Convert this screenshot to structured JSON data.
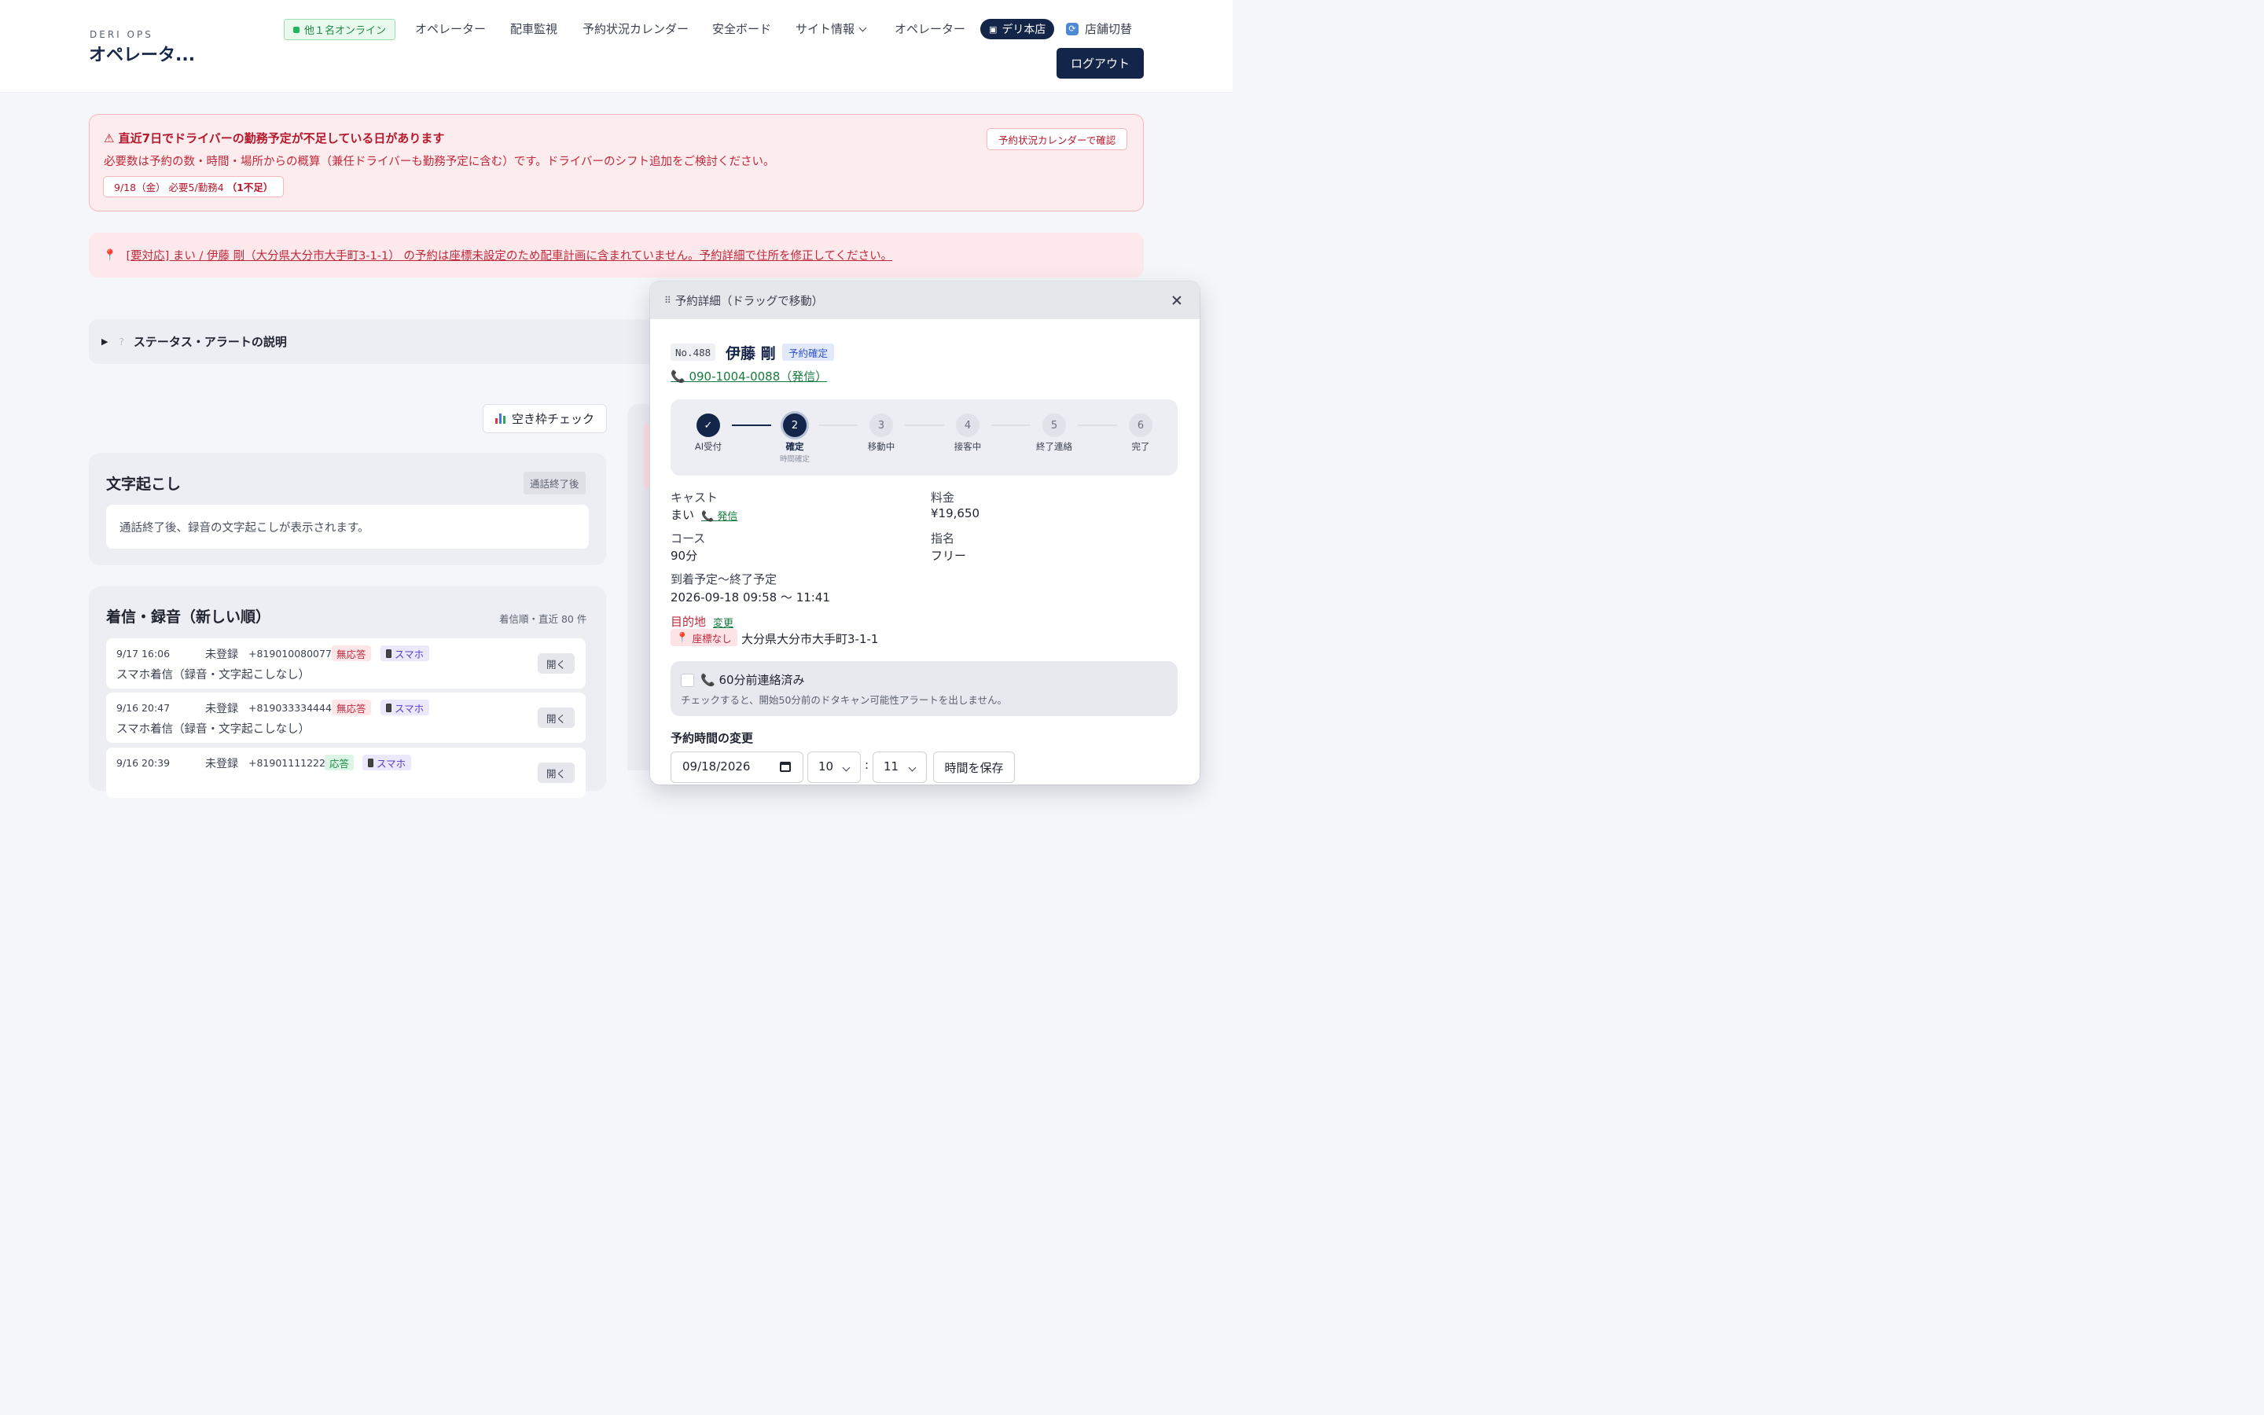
{
  "header": {
    "brand_sub": "DERI OPS",
    "brand_title": "オペレータ...",
    "online_badge": "他１名オンライン",
    "nav": {
      "operator": "オペレーター",
      "dispatch": "配車監視",
      "calendar": "予約状況カレンダー",
      "safety": "安全ボード",
      "site_info": "サイト情報",
      "operator2": "オペレーター"
    },
    "store_label": "デリ本店",
    "store_switch": "店舗切替",
    "logout": "ログアウト"
  },
  "shortage_alert": {
    "title": "⚠ 直近7日でドライバーの勤務予定が不足している日があります",
    "description": "必要数は予約の数・時間・場所からの概算（兼任ドライバーも勤務予定に含む）です。ドライバーのシフト追加をご検討ください。",
    "chip_text": "9/18（金） 必要5/勤務4",
    "chip_strong": "（1不足）",
    "button": "予約状況カレンダーで確認"
  },
  "coord_notice": {
    "text": "[要対応] まい / 伊藤 剛（大分県大分市大手町3-1-1） の予約は座標未設定のため配車計画に含まれていません。予約詳細で住所を修正してください。"
  },
  "status_explainer": {
    "label": "ステータス・アラートの説明"
  },
  "vacancy_button": "空き枠チェック",
  "transcript": {
    "title": "文字起こし",
    "tag": "通話終了後",
    "body": "通話終了後、録音の文字起こしが表示されます。"
  },
  "calls": {
    "title": "着信・録音（新しい順）",
    "meta": "着信順・直近 80 件",
    "open_label": "開く",
    "rows": [
      {
        "time": "9/17 16:06",
        "name": "未登録",
        "number": "+819010080077",
        "status": "無応答",
        "device": "スマホ",
        "desc": "スマホ着信（録音・文字起こしなし）"
      },
      {
        "time": "9/16 20:47",
        "name": "未登録",
        "number": "+819033334444",
        "status": "無応答",
        "device": "スマホ",
        "desc": "スマホ着信（録音・文字起こしなし）"
      },
      {
        "time": "9/16 20:39",
        "name": "未登録",
        "number": "+819011112222",
        "status": "応答",
        "device": "スマホ",
        "desc": ""
      }
    ]
  },
  "modal": {
    "title": "予約詳細（ドラッグで移動）",
    "res_no": "No.488",
    "customer": "伊藤 剛",
    "status": "予約確定",
    "phone": "090-1004-0088（発信）",
    "steps": [
      {
        "n": "✓",
        "label": "AI受付",
        "sub": "",
        "state": "done"
      },
      {
        "n": "2",
        "label": "確定",
        "sub": "時間確定",
        "state": "current"
      },
      {
        "n": "3",
        "label": "移動中",
        "sub": "",
        "state": "todo"
      },
      {
        "n": "4",
        "label": "接客中",
        "sub": "",
        "state": "todo"
      },
      {
        "n": "5",
        "label": "終了連絡",
        "sub": "",
        "state": "todo"
      },
      {
        "n": "6",
        "label": "完了",
        "sub": "",
        "state": "todo"
      }
    ],
    "cast_label": "キャスト",
    "cast_value": "まい",
    "cast_call": "発信",
    "fee_label": "料金",
    "fee_value": "¥19,650",
    "course_label": "コース",
    "course_value": "90分",
    "nomination_label": "指名",
    "nomination_value": "フリー",
    "schedule_label": "到着予定〜終了予定",
    "schedule_value": "2026-09-18 09:58 〜 11:41",
    "dest_label": "目的地",
    "dest_change": "変更",
    "coord_badge": "座標なし",
    "dest_address": "大分県大分市大手町3-1-1",
    "contact_label": "60分前連絡済み",
    "contact_hint": "チェックすると、開始50分前のドタキャン可能性アラートを出しません。",
    "change_title": "予約時間の変更",
    "date_value": "09/18/2026",
    "hour_value": "10",
    "minute_value": "11",
    "save_time": "時間を保存"
  },
  "colors": {
    "navy": "#14254a",
    "alert_red": "#c0293b",
    "green": "#167a3e"
  }
}
